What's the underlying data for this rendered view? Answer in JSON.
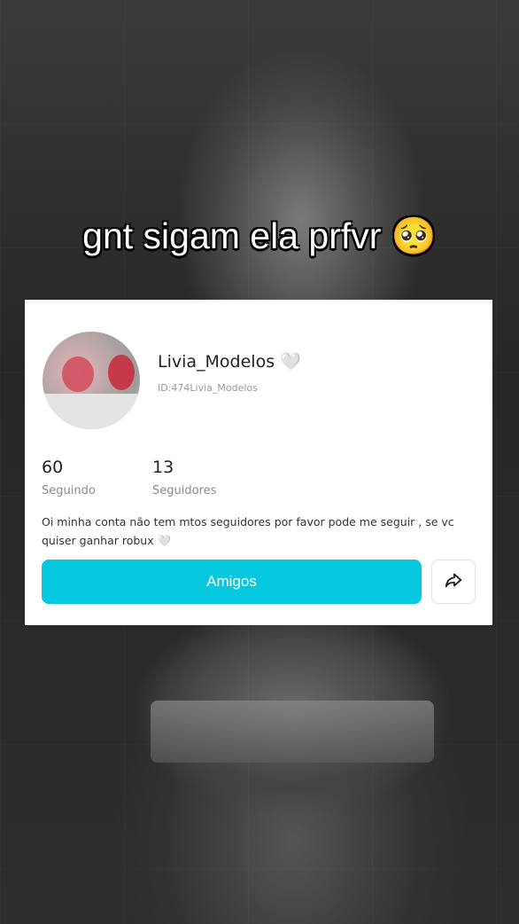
{
  "caption": "gnt sigam ela prfvr 🥺",
  "profile": {
    "username": "Livia_Modelos 🤍",
    "id": "ID:474Livia_Modelos",
    "stats": [
      {
        "value": "60",
        "label": "Seguindo"
      },
      {
        "value": "13",
        "label": "Seguidores"
      }
    ],
    "bio": "Oi minha conta não tem mtos seguidores por favor pode me seguir , se vc quiser ganhar robux 🤍",
    "friends_button": "Amigos",
    "share_icon": "share-arrow-icon"
  },
  "colors": {
    "accent": "#06c8e0",
    "card_bg": "#ffffff",
    "text": "#222222",
    "muted": "#8a8a8a"
  }
}
